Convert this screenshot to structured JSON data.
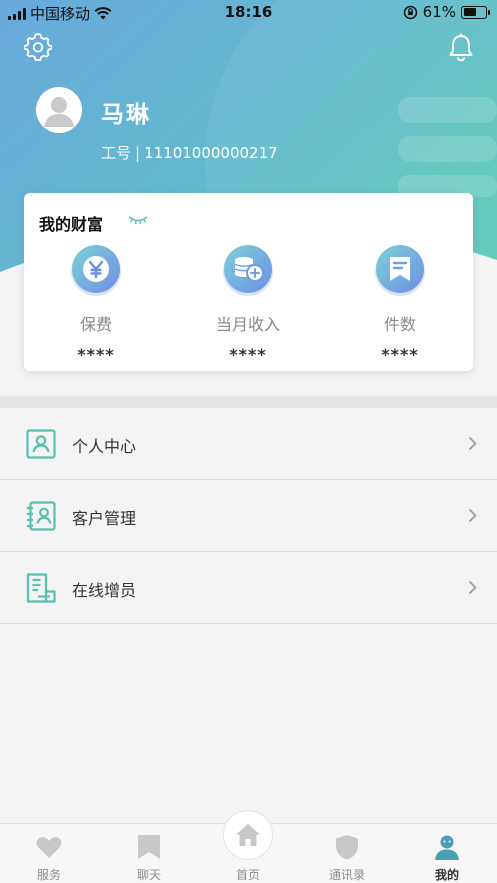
{
  "status_bar": {
    "carrier": "中国移动",
    "time": "18:16",
    "battery_text": "61%",
    "battery_level": 0.61
  },
  "profile": {
    "name": "马琳",
    "id_label": "工号",
    "id_separator": "|",
    "id_value": "11101000000217"
  },
  "wealth": {
    "title": "我的财富",
    "stats": [
      {
        "label": "保费",
        "value": "****",
        "icon": "yen-coin-icon"
      },
      {
        "label": "当月收入",
        "value": "****",
        "icon": "coin-stack-plus-icon"
      },
      {
        "label": "件数",
        "value": "****",
        "icon": "document-bookmark-icon"
      }
    ]
  },
  "menu": [
    {
      "label": "个人中心",
      "icon": "person-card-icon"
    },
    {
      "label": "客户管理",
      "icon": "client-book-icon"
    },
    {
      "label": "在线增员",
      "icon": "document-stack-icon"
    }
  ],
  "tabs": [
    {
      "label": "服务",
      "icon": "heart-icon"
    },
    {
      "label": "聊天",
      "icon": "bookmark-icon"
    },
    {
      "label": "首页",
      "icon": "home-icon"
    },
    {
      "label": "通讯录",
      "icon": "shield-icon"
    },
    {
      "label": "我的",
      "icon": "person-icon",
      "active": true
    }
  ],
  "colors": {
    "header_start": "#5ea9dc",
    "header_end": "#5cc5bd",
    "accent_teal": "#5bbfb0",
    "active_tab": "#4a9fb5"
  }
}
